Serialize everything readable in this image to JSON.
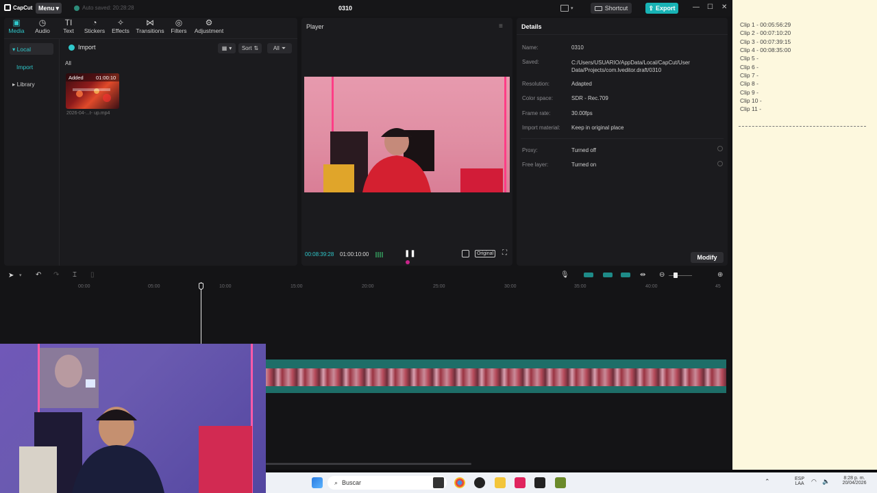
{
  "app": {
    "logo": "CapCut",
    "menu_label": "Menu",
    "autosave": "Auto saved: 20:28:28",
    "project_title": "0310",
    "shortcut_label": "Shortcut",
    "export_label": "Export"
  },
  "toolbar": {
    "tabs": [
      {
        "label": "Media",
        "icon": "media-icon"
      },
      {
        "label": "Audio",
        "icon": "audio-icon"
      },
      {
        "label": "Text",
        "icon": "text-icon"
      },
      {
        "label": "Stickers",
        "icon": "stickers-icon"
      },
      {
        "label": "Effects",
        "icon": "effects-icon"
      },
      {
        "label": "Transitions",
        "icon": "transitions-icon"
      },
      {
        "label": "Filters",
        "icon": "filters-icon"
      },
      {
        "label": "Adjustment",
        "icon": "adjustment-icon"
      }
    ]
  },
  "sidebar": {
    "items": [
      {
        "label": "Local"
      },
      {
        "label": "Import"
      },
      {
        "label": "Library"
      }
    ]
  },
  "media": {
    "import_label": "Import",
    "sort_label": "Sort",
    "all_filter": "All",
    "section_all": "All",
    "clip": {
      "badge": "Added",
      "duration": "01:00:10",
      "name": "2026-04-...t- up.mp4"
    }
  },
  "player": {
    "title": "Player",
    "current_time": "00:08:39:28",
    "total_time": "01:00:10:00",
    "original_label": "Original"
  },
  "details": {
    "title": "Details",
    "rows": [
      {
        "label": "Name:",
        "value": "0310"
      },
      {
        "label": "Saved:",
        "value": "C:/Users/USUARIO/AppData/Local/CapCut/User Data/Projects/com.lveditor.draft/0310"
      },
      {
        "label": "Resolution:",
        "value": "Adapted"
      },
      {
        "label": "Color space:",
        "value": "SDR - Rec.709"
      },
      {
        "label": "Frame rate:",
        "value": "30.00fps"
      },
      {
        "label": "Import material:",
        "value": "Keep in original place"
      },
      {
        "label": "Proxy:",
        "value": "Turned off"
      },
      {
        "label": "Free layer:",
        "value": "Turned on"
      }
    ],
    "modify_label": "Modify"
  },
  "timeline": {
    "ruler": [
      "00:00",
      "05:00",
      "10:00",
      "15:00",
      "20:00",
      "25:00",
      "30:00",
      "35:00",
      "40:00",
      "45"
    ]
  },
  "notepad": {
    "lines": [
      "Clip 1 - 00:05:56:29",
      "Clip 2 - 00:07:10:20",
      "Clip 3 - 00:07:39:15",
      "Clip 4 - 00:08:35:00",
      "Clip 5 -",
      "Clip 6 -",
      "Clip 7 -",
      "Clip 8 -",
      "Clip 9 -",
      "Clip 10 -",
      "Clip 11 -"
    ]
  },
  "taskbar": {
    "search_placeholder": "Buscar",
    "lang_top": "ESP",
    "lang_bottom": "LAA",
    "time": "8:28 p. m.",
    "date": "20/04/2026"
  },
  "colors": {
    "accent": "#2fc8cb",
    "track": "#1e6e68",
    "notepad_bg": "#fdf8de"
  }
}
